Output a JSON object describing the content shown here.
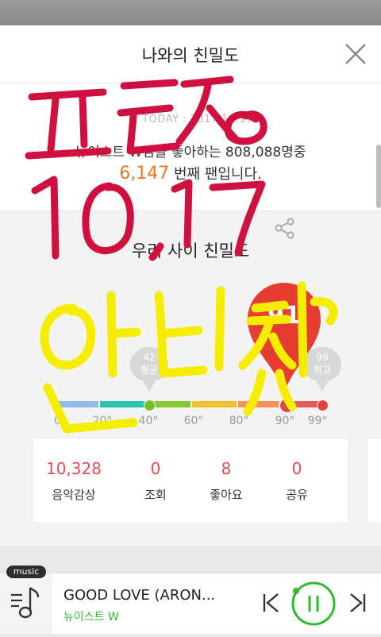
{
  "header": {
    "title": "나와의 친밀도"
  },
  "info": {
    "today": "© TODAY : 2017.10.17",
    "fan_line1": "뉴이스트 W님을 좋아하는 808,088명중",
    "rank": "6,147",
    "fan_line2_suffix": " 번째 팬입니다."
  },
  "intimacy": {
    "title": "우리 사이 친밀도",
    "score": 91,
    "average": {
      "value": "42",
      "label": "평균"
    },
    "max": {
      "value": "99",
      "label": "최고"
    },
    "ticks": [
      "0°",
      "20°",
      "40°",
      "60°",
      "80°",
      "90°",
      "99°"
    ],
    "scale_colors": [
      "#8fbde8",
      "#2ac4b0",
      "#85c834",
      "#f2c12b",
      "#f59358",
      "#e25a5a"
    ]
  },
  "stats": [
    {
      "value": "10,328",
      "label": "음악감상"
    },
    {
      "value": "0",
      "label": "조회"
    },
    {
      "value": "8",
      "label": "좋아요"
    },
    {
      "value": "0",
      "label": "공유"
    }
  ],
  "player": {
    "badge": "music",
    "song_title": "GOOD LOVE (ARON...",
    "artist": "뉴이스트 W",
    "accent": "#2dbb2d"
  },
  "annotations": {
    "red_text_line1": "ㅍㅌㅈㅇ",
    "red_text_line2": "10.17",
    "yellow_text": "인티결치",
    "red_color": "#d0103f",
    "yellow_color": "#f5ee00"
  }
}
